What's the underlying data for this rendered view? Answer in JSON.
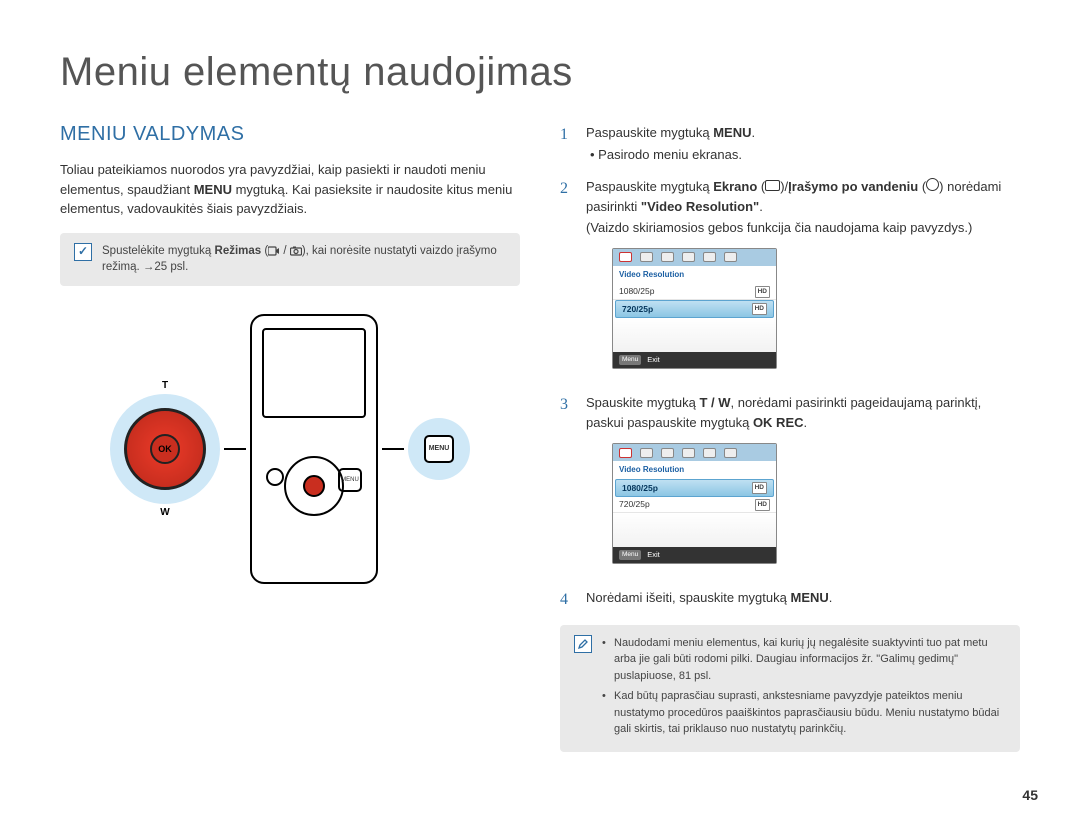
{
  "page": {
    "title": "Meniu elementų naudojimas",
    "section_heading": "MENIU VALDYMAS",
    "intro_part1": "Toliau pateikiamos nuorodos yra pavyzdžiai, kaip pasiekti ir naudoti meniu elementus, spaudžiant ",
    "intro_bold": "MENU",
    "intro_part2": " mygtuką. Kai pasieksite ir naudosite kitus meniu elementus, vadovaukitės šiais pavyzdžiais.",
    "page_number": "45"
  },
  "tip_box": {
    "text_part1": "Spustelėkite mygtuką ",
    "text_bold1": "Režimas",
    "text_mid": " (",
    "text_part2": "), kai norėsite nustatyti vaizdo įrašymo režimą. ",
    "text_ref": "25 psl."
  },
  "steps": {
    "s1_a": "Paspauskite mygtuką ",
    "s1_b": "MENU",
    "s1_c": ".",
    "s1_bullet": "Pasirodo meniu ekranas.",
    "s2_a": "Paspauskite mygtuką ",
    "s2_b": "Ekrano",
    "s2_c": " (",
    "s2_d": ")/",
    "s2_e": "Įrašymo po vandeniu",
    "s2_f": " (",
    "s2_g": ") norėdami pasirinkti ",
    "s2_h": "\"Video Resolution\"",
    "s2_i": ".",
    "s2_note": "(Vaizdo skiriamosios gebos funkcija čia naudojama kaip pavyzdys.)",
    "s3_a": "Spauskite mygtuką ",
    "s3_b": "T / W",
    "s3_c": ", norėdami pasirinkti pageidaujamą parinktį, paskui paspauskite mygtuką ",
    "s3_d": "OK REC",
    "s3_e": ".",
    "s4_a": "Norėdami išeiti, spauskite mygtuką ",
    "s4_b": "MENU",
    "s4_c": "."
  },
  "ui": {
    "section": "Video Resolution",
    "opt1": "1080/25p",
    "opt2": "720/25p",
    "hd": "HD",
    "footer_btn": "Menu",
    "footer_text": "Exit"
  },
  "footnote": {
    "n1": "Naudodami meniu elementus, kai kurių jų negalėsite suaktyvinti tuo pat metu arba jie gali būti rodomi pilki. Daugiau informacijos žr. \"Galimų gedimų\" puslapiuose, 81 psl.",
    "n2": "Kad būtų paprasčiau suprasti, ankstesniame pavyzdyje pateiktos meniu nustatymo procedūros paaiškintos paprasčiausiu būdu. Meniu nustatymo būdai gali skirtis, tai priklauso nuo nustatytų parinkčių."
  },
  "controls": {
    "ok": "OK",
    "t": "T",
    "w": "W",
    "menu": "MENU"
  }
}
